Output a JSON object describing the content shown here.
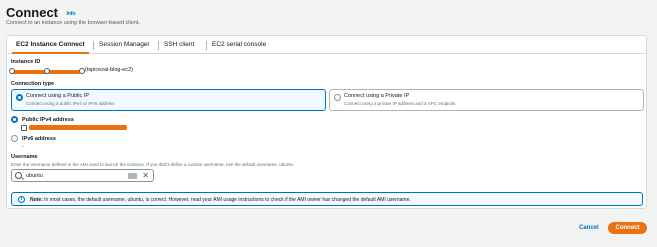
{
  "page": {
    "title": "Connect",
    "info_link": "Info",
    "subtitle": "Connect to an instance using the browser-based client."
  },
  "tabs": [
    {
      "label": "EC2 Instance Connect",
      "active": true
    },
    {
      "label": "Session Manager",
      "active": false
    },
    {
      "label": "SSH client",
      "active": false
    },
    {
      "label": "EC2 serial console",
      "active": false
    }
  ],
  "instance": {
    "label": "Instance ID",
    "name": "(tspicezai-blog-ec2)"
  },
  "connection_type": {
    "label": "Connection type",
    "options": [
      {
        "title": "Connect using a Public IP",
        "desc": "Connect using a public IPv4 or IPv6 address",
        "selected": true
      },
      {
        "title": "Connect using a Private IP",
        "desc": "Connect using a private IP address and a VPC endpoint",
        "selected": false
      }
    ]
  },
  "address": {
    "ipv4_label": "Public IPv4 address",
    "ipv6_label": "IPv6 address",
    "ipv6_value": "–"
  },
  "username": {
    "label": "Username",
    "desc": "Enter the username defined in the AMI used to launch the instance. If you didn't define a custom username, use the default username, ubuntu.",
    "value": "ubuntu"
  },
  "note": {
    "bold": "Note:",
    "text": " In most cases, the default username, ubuntu, is correct. However, read your AMI usage instructions to check if the AMI owner has changed the default AMI username."
  },
  "footer": {
    "cancel": "Cancel",
    "connect": "Connect"
  },
  "colors": {
    "accent": "#ec7211",
    "link": "#0073bb"
  }
}
